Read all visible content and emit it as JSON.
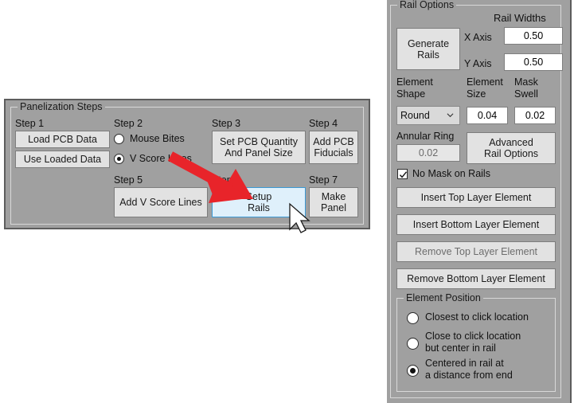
{
  "left_panel": {
    "group_title": "Panelization Steps",
    "steps": [
      {
        "label": "Step 1"
      },
      {
        "label": "Step 2"
      },
      {
        "label": "Step 3"
      },
      {
        "label": "Step 4"
      },
      {
        "label": "Step 5"
      },
      {
        "label": "Step 6"
      },
      {
        "label": "Step 7"
      }
    ],
    "buttons": {
      "load_pcb_data": "Load PCB Data",
      "use_loaded_data": "Use Loaded Data",
      "set_pcb_quantity": "Set PCB Quantity\nAnd Panel Size",
      "add_pcb_fiducials": "Add PCB\nFiducials",
      "add_v_score_lines": "Add V Score Lines",
      "setup_rails": "Setup\nRails",
      "make_panel": "Make\nPanel"
    },
    "radios": [
      {
        "label": "Mouse Bites",
        "selected": false
      },
      {
        "label": "V Score Lines",
        "selected": true
      }
    ]
  },
  "right_panel": {
    "group_title": "Rail Options",
    "rail_widths_label": "Rail Widths",
    "generate_rails_button": "Generate\nRails",
    "x_axis_label": "X Axis",
    "x_axis_value": "0.50",
    "y_axis_label": "Y Axis",
    "y_axis_value": "0.50",
    "element_shape_label": "Element\nShape",
    "element_shape_value": "Round",
    "element_size_label": "Element\nSize",
    "element_size_value": "0.04",
    "mask_swell_label": "Mask\nSwell",
    "mask_swell_value": "0.02",
    "annular_ring_label": "Annular Ring",
    "annular_ring_value": "0.02",
    "advanced_rail_options_button": "Advanced\nRail Options",
    "no_mask_checkbox_label": "No Mask on Rails",
    "no_mask_checked": true,
    "insert_top_layer_button": "Insert Top Layer Element",
    "insert_bottom_layer_button": "Insert Bottom Layer Element",
    "remove_top_layer_button": "Remove Top Layer Element",
    "remove_bottom_layer_button": "Remove Bottom Layer Element",
    "element_position": {
      "group_title": "Element Position",
      "options": [
        {
          "label": "Closest to click location",
          "selected": false
        },
        {
          "label": "Close to click location\nbut center in rail",
          "selected": false
        },
        {
          "label": "Centered in rail at\na distance from end",
          "selected": true
        }
      ]
    }
  },
  "annotation": {
    "arrow_color": "#e8242a",
    "arrow_name": "red-callout-arrow"
  },
  "colors": {
    "panel_bg": "#a0a0a0",
    "button_face": "#e2e2e2",
    "hover_blue_bg": "#dff0fb",
    "hover_blue_border": "#3c99d4",
    "page_bg": "#ffffff"
  }
}
